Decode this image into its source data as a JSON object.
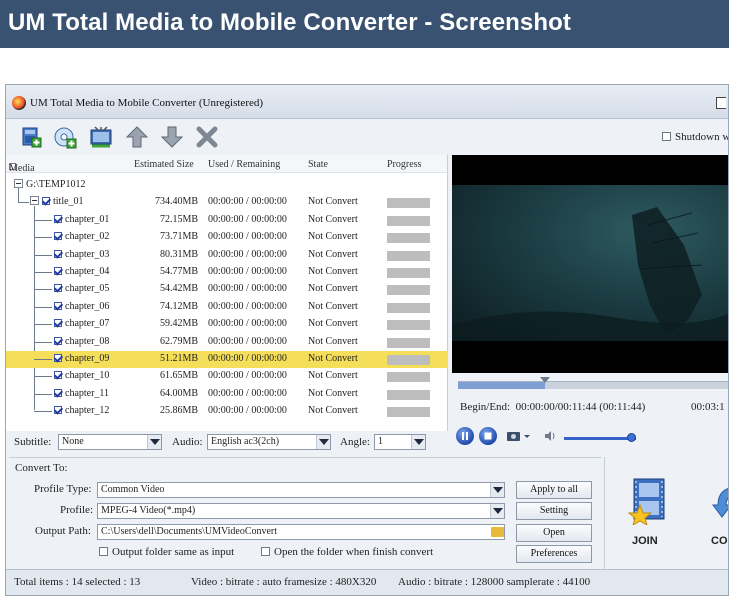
{
  "banner": {
    "title": "UM Total Media to Mobile Converter - Screenshot"
  },
  "window": {
    "title": "UM Total Media to Mobile Converter  (Unregistered)"
  },
  "toolbar": {
    "buttons": [
      "add-file",
      "add-folder",
      "edit",
      "move-up",
      "move-down",
      "remove"
    ],
    "shutdown_label": "Shutdown w"
  },
  "list": {
    "headers": {
      "media": "Media",
      "size": "Estimated Size",
      "used": "Used / Remaining",
      "state": "State",
      "progress": "Progress"
    },
    "root": "G:\\TEMP1012",
    "title": {
      "name": "title_01",
      "size": "734.40MB",
      "used": "00:00:00 / 00:00:00",
      "state": "Not Convert"
    },
    "chapters": [
      {
        "name": "chapter_01",
        "size": "72.15MB",
        "used": "00:00:00 / 00:00:00",
        "state": "Not Convert"
      },
      {
        "name": "chapter_02",
        "size": "73.71MB",
        "used": "00:00:00 / 00:00:00",
        "state": "Not Convert"
      },
      {
        "name": "chapter_03",
        "size": "80.31MB",
        "used": "00:00:00 / 00:00:00",
        "state": "Not Convert"
      },
      {
        "name": "chapter_04",
        "size": "54.77MB",
        "used": "00:00:00 / 00:00:00",
        "state": "Not Convert"
      },
      {
        "name": "chapter_05",
        "size": "54.42MB",
        "used": "00:00:00 / 00:00:00",
        "state": "Not Convert"
      },
      {
        "name": "chapter_06",
        "size": "74.12MB",
        "used": "00:00:00 / 00:00:00",
        "state": "Not Convert"
      },
      {
        "name": "chapter_07",
        "size": "59.42MB",
        "used": "00:00:00 / 00:00:00",
        "state": "Not Convert"
      },
      {
        "name": "chapter_08",
        "size": "62.79MB",
        "used": "00:00:00 / 00:00:00",
        "state": "Not Convert"
      },
      {
        "name": "chapter_09",
        "size": "51.21MB",
        "used": "00:00:00 / 00:00:00",
        "state": "Not Convert"
      },
      {
        "name": "chapter_10",
        "size": "61.65MB",
        "used": "00:00:00 / 00:00:00",
        "state": "Not Convert"
      },
      {
        "name": "chapter_11",
        "size": "64.00MB",
        "used": "00:00:00 / 00:00:00",
        "state": "Not Convert"
      },
      {
        "name": "chapter_12",
        "size": "25.86MB",
        "used": "00:00:00 / 00:00:00",
        "state": "Not Convert"
      }
    ]
  },
  "player": {
    "begin_end_label": "Begin/End:",
    "begin_end_value": "00:00:00/00:11:44",
    "duration_value": "(00:11:44)",
    "right_time": "00:03:1",
    "position_fraction": 0.32,
    "volume_fraction": 0.95
  },
  "subtitle_bar": {
    "subtitle_label": "Subtitle:",
    "subtitle_value": "None",
    "audio_label": "Audio:",
    "audio_value": "English ac3(2ch)",
    "angle_label": "Angle:",
    "angle_value": "1"
  },
  "convert": {
    "section_label": "Convert To:",
    "profile_type_label": "Profile Type:",
    "profile_type_value": "Common Video",
    "profile_label": "Profile:",
    "profile_value": "MPEG-4 Video(*.mp4)",
    "output_label": "Output Path:",
    "output_value": "C:\\Users\\dell\\Documents\\UMVideoConvert",
    "same_as_input_label": "Output folder same as input",
    "open_when_finish_label": "Open the folder when finish convert",
    "apply_all_label": "Apply to all",
    "setting_label": "Setting",
    "open_label": "Open",
    "preferences_label": "Preferences",
    "join_label": "JOIN",
    "convert_label": "CO"
  },
  "status": {
    "items": "Total items : 14  selected : 13",
    "video": "Video : bitrate : auto framesize : 480X320",
    "audio": "Audio : bitrate : 128000 samplerate : 44100"
  },
  "colors": {
    "banner": "#3a5271",
    "selected_row": "#f5df5a",
    "accent_blue": "#3563c9"
  }
}
